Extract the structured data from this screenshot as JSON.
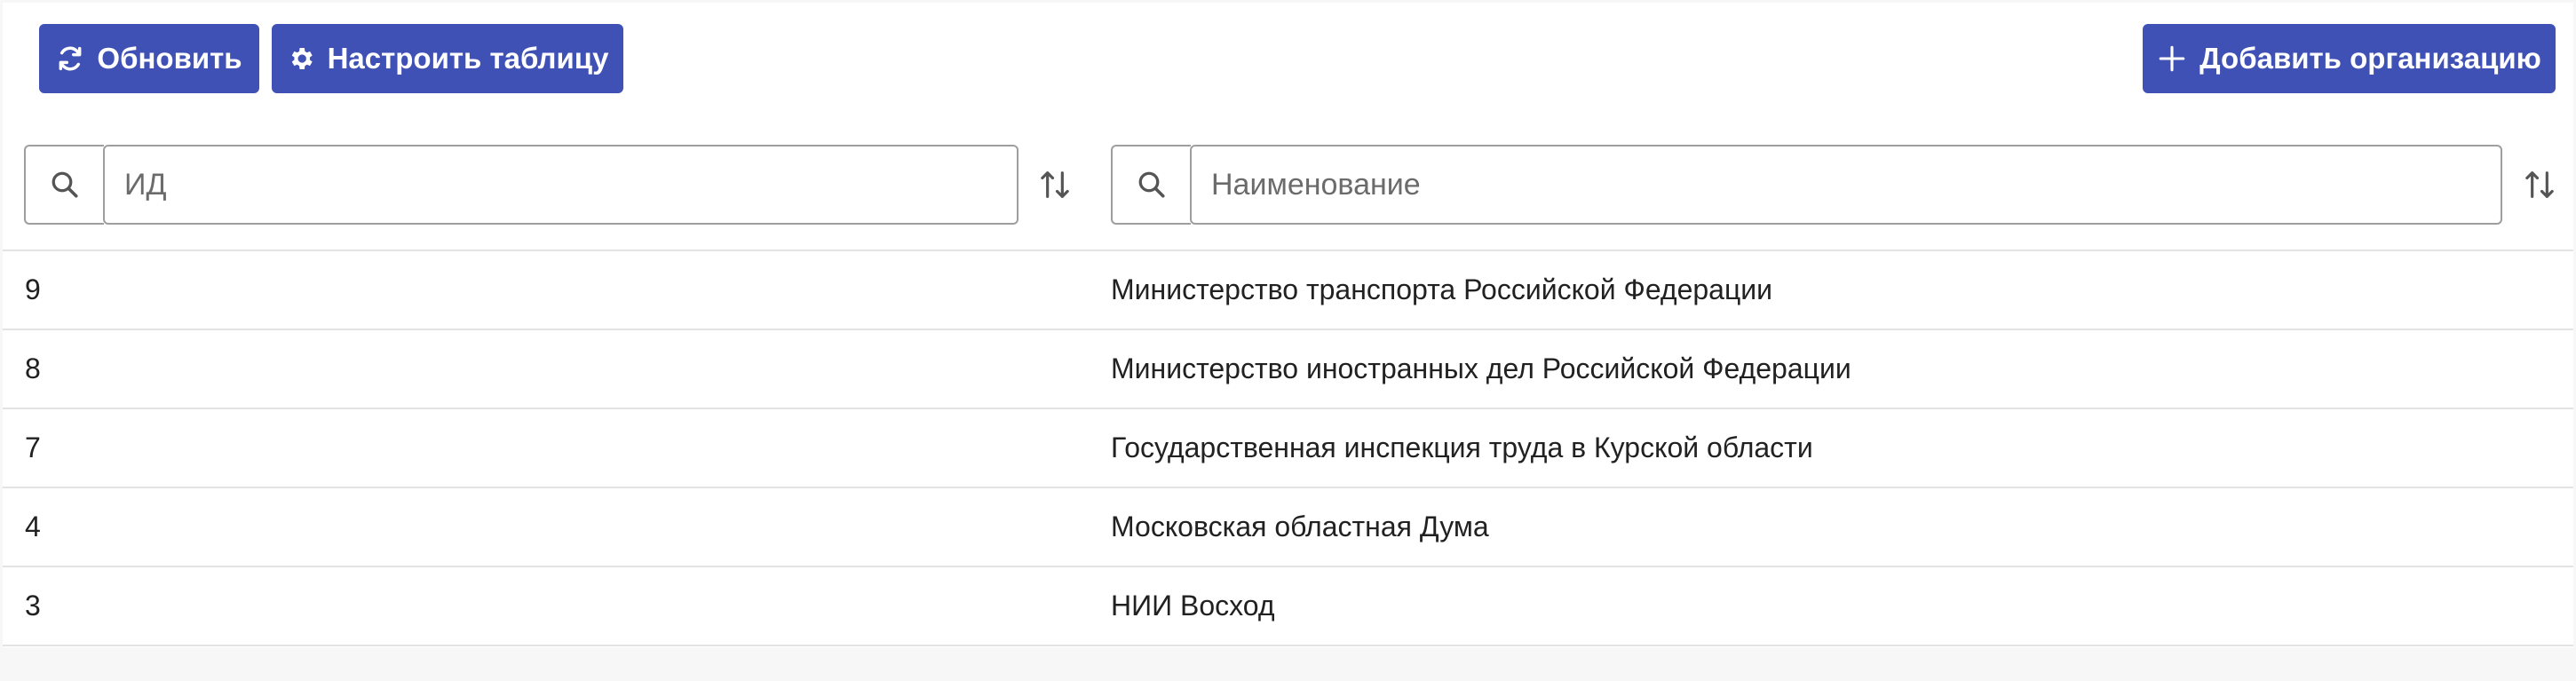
{
  "toolbar": {
    "refresh_label": "Обновить",
    "settings_label": "Настроить таблицу",
    "add_label": "Добавить организацию"
  },
  "filters": {
    "id_placeholder": "ИД",
    "name_placeholder": "Наименование"
  },
  "rows": [
    {
      "id": "9",
      "name": "Министерство транспорта Российской Федерации"
    },
    {
      "id": "8",
      "name": "Министерство иностранных дел Российской Федерации"
    },
    {
      "id": "7",
      "name": "Государственная инспекция труда в Курской области"
    },
    {
      "id": "4",
      "name": "Московская областная Дума"
    },
    {
      "id": "3",
      "name": "НИИ Восход"
    }
  ],
  "icons": {
    "refresh": "refresh-icon",
    "settings": "gear-icon",
    "add": "plus-icon",
    "search": "search-icon",
    "sort": "sort-icon"
  },
  "colors": {
    "primary": "#3f51b5",
    "border": "#9e9e9e",
    "row_divider": "#e3e3e3",
    "background": "#f7f7f7"
  }
}
